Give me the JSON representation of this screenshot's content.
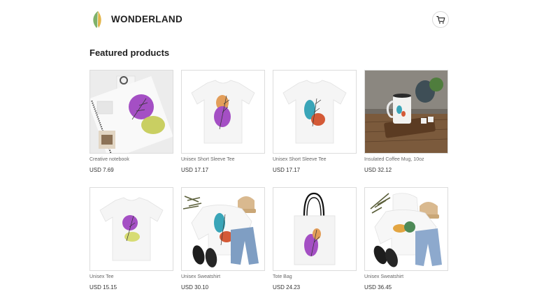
{
  "brand": {
    "name": "WONDERLAND"
  },
  "icons": {
    "logo": "leaf-logo-icon",
    "cart": "shopping-cart-icon"
  },
  "section": {
    "title": "Featured products"
  },
  "products": [
    {
      "name": "Creative notebook",
      "price": "USD 7.69"
    },
    {
      "name": "Unisex Short Sleeve Tee",
      "price": "USD 17.17"
    },
    {
      "name": "Unisex Short Sleeve Tee",
      "price": "USD 17.17"
    },
    {
      "name": "Insulated Coffee Mug, 10oz",
      "price": "USD 32.12"
    },
    {
      "name": "Unisex Tee",
      "price": "USD 15.15"
    },
    {
      "name": "Unisex Sweatshirt",
      "price": "USD 30.10"
    },
    {
      "name": "Tote Bag",
      "price": "USD 24.23"
    },
    {
      "name": "Unisex Sweatshirt",
      "price": "USD 36.45"
    }
  ],
  "colors": {
    "purple": "#a44fc4",
    "teal": "#3aa5b8",
    "orange": "#d9824a",
    "red": "#d45a37",
    "lime": "#c9cf62",
    "green": "#4e8a57"
  }
}
